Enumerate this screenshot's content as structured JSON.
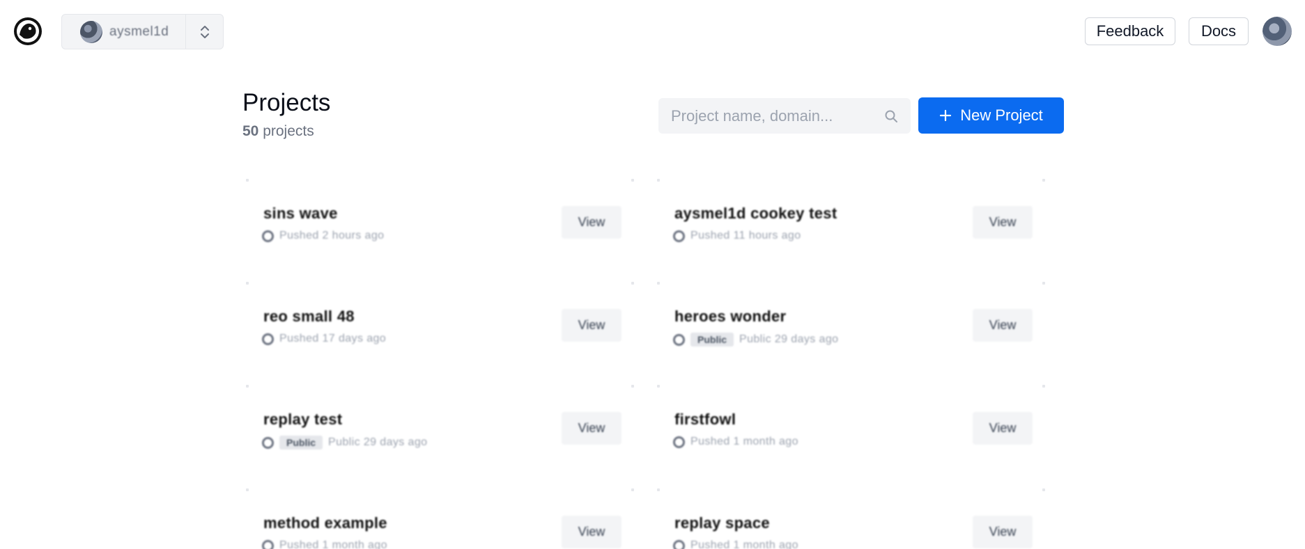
{
  "topbar": {
    "team_name": "aysmel1d",
    "feedback_label": "Feedback",
    "docs_label": "Docs"
  },
  "header": {
    "title": "Projects",
    "count": "50",
    "count_suffix": "projects",
    "search_placeholder": "Project name, domain...",
    "new_project_label": "New Project"
  },
  "projects": [
    {
      "name": "sins wave",
      "meta": "Pushed 2 hours ago",
      "badge": "",
      "view": "View"
    },
    {
      "name": "aysmel1d cookey test",
      "meta": "Pushed 11 hours ago",
      "badge": "",
      "view": "View"
    },
    {
      "name": "reo small 48",
      "meta": "Pushed 17 days ago",
      "badge": "",
      "view": "View"
    },
    {
      "name": "heroes wonder",
      "meta": "Public 29 days ago",
      "badge": "Public",
      "view": "View"
    },
    {
      "name": "replay test",
      "meta": "Public 29 days ago",
      "badge": "Public",
      "view": "View"
    },
    {
      "name": "firstfowl",
      "meta": "Pushed 1 month ago",
      "badge": "",
      "view": "View"
    },
    {
      "name": "method example",
      "meta": "Pushed 1 month ago",
      "badge": "",
      "view": "View"
    },
    {
      "name": "replay space",
      "meta": "Pushed 1 month ago",
      "badge": "",
      "view": "View"
    }
  ],
  "colors": {
    "primary": "#0b6bf0",
    "muted": "#6b7280",
    "surface": "#f3f4f6"
  }
}
